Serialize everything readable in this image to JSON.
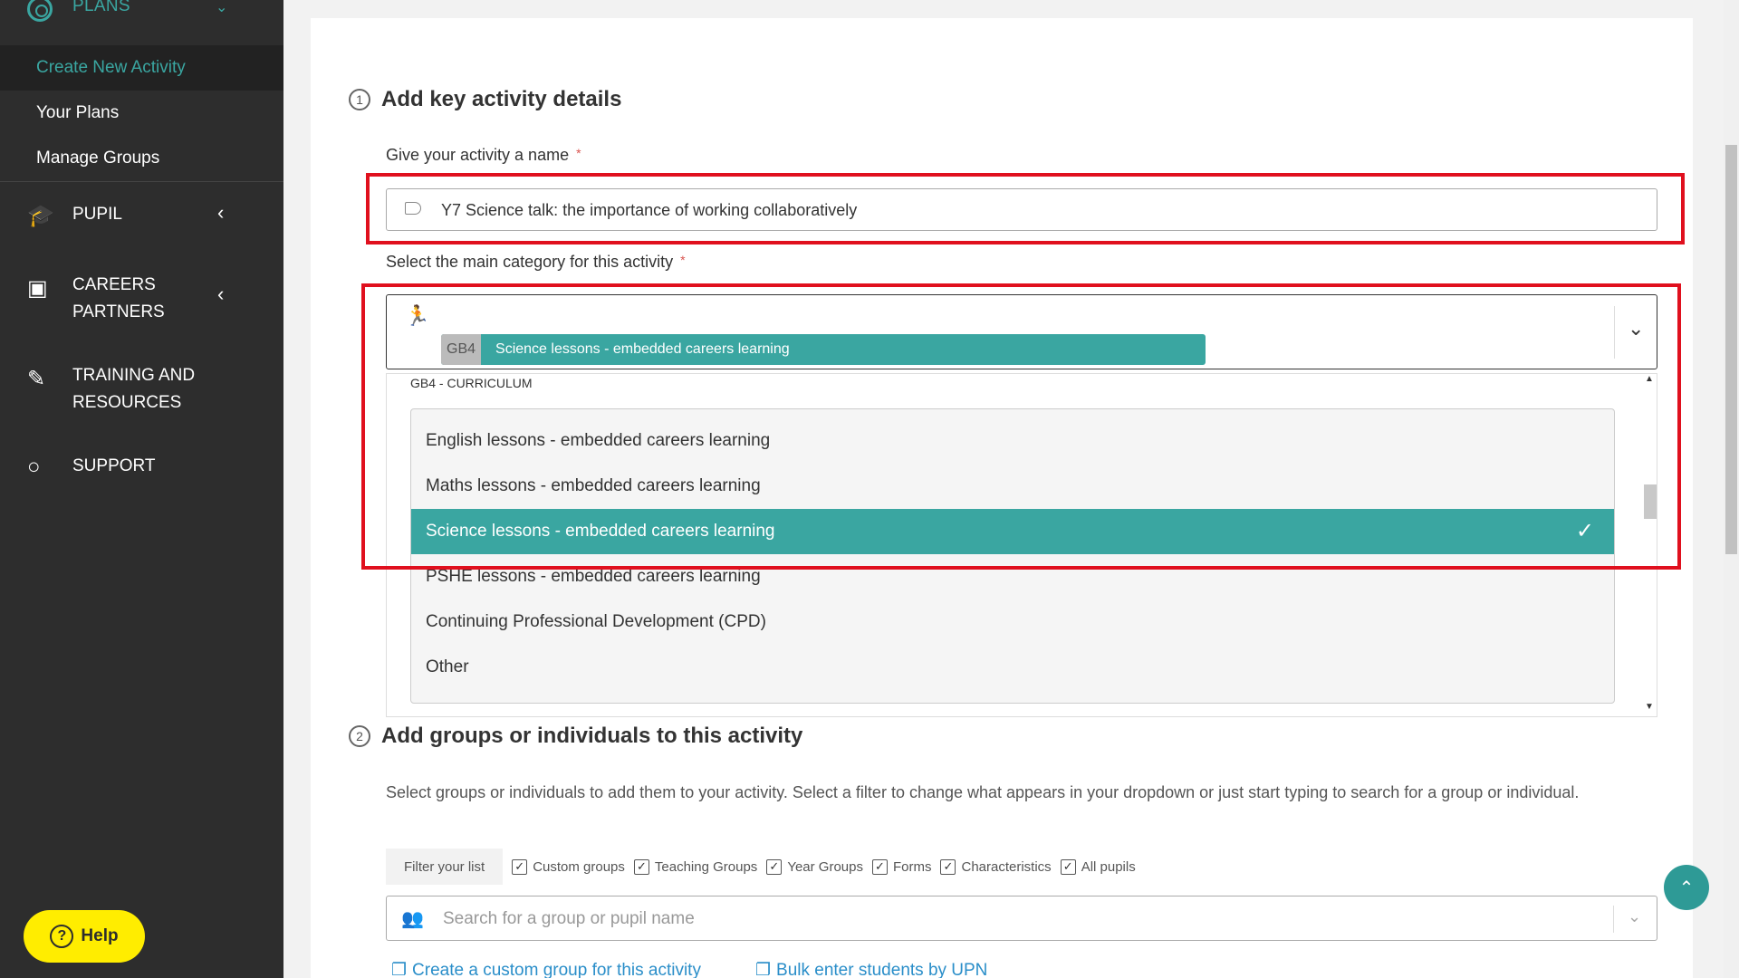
{
  "sidebar": {
    "plans_label": "PLANS",
    "sub_items": [
      "Create New Activity",
      "Your Plans",
      "Manage Groups"
    ],
    "pupil_label": "PUPIL",
    "careers_label_1": "CAREERS",
    "careers_label_2": "PARTNERS",
    "training_label_1": "TRAINING AND",
    "training_label_2": "RESOURCES",
    "support_label": "SUPPORT",
    "help_label": "Help"
  },
  "section1": {
    "step_number": "1",
    "title": "Add key activity details",
    "name_label": "Give your activity a name",
    "name_value": "Y7 Science talk: the importance of working collaboratively",
    "category_label": "Select the main category for this activity",
    "required_mark": "*",
    "selected_chip": {
      "code": "GB4",
      "text": "Science lessons - embedded careers learning"
    },
    "group_heading": "GB4 - CURRICULUM",
    "options": [
      "English lessons - embedded careers learning",
      "Maths lessons - embedded careers learning",
      "Science lessons - embedded careers learning",
      "PSHE lessons - embedded careers learning",
      "Continuing Professional Development (CPD)",
      "Other"
    ],
    "selected_index": 2
  },
  "section2": {
    "step_number": "2",
    "title": "Add groups or individuals to this activity",
    "description": "Select groups or individuals to add them to your activity. Select a filter to change what appears in your dropdown or just start typing to search for a group or individual.",
    "filter_label": "Filter your list",
    "filters": [
      "Custom groups",
      "Teaching Groups",
      "Year Groups",
      "Forms",
      "Characteristics",
      "All pupils"
    ],
    "search_placeholder": "Search for a group or pupil name",
    "link_custom_group": "Create a custom group for this activity",
    "link_bulk_upn": "Bulk enter students by UPN"
  },
  "colors": {
    "accent": "#3aa6a1",
    "highlight": "#e0101e",
    "help": "#ffed00",
    "sidebar": "#2d2d2d"
  }
}
